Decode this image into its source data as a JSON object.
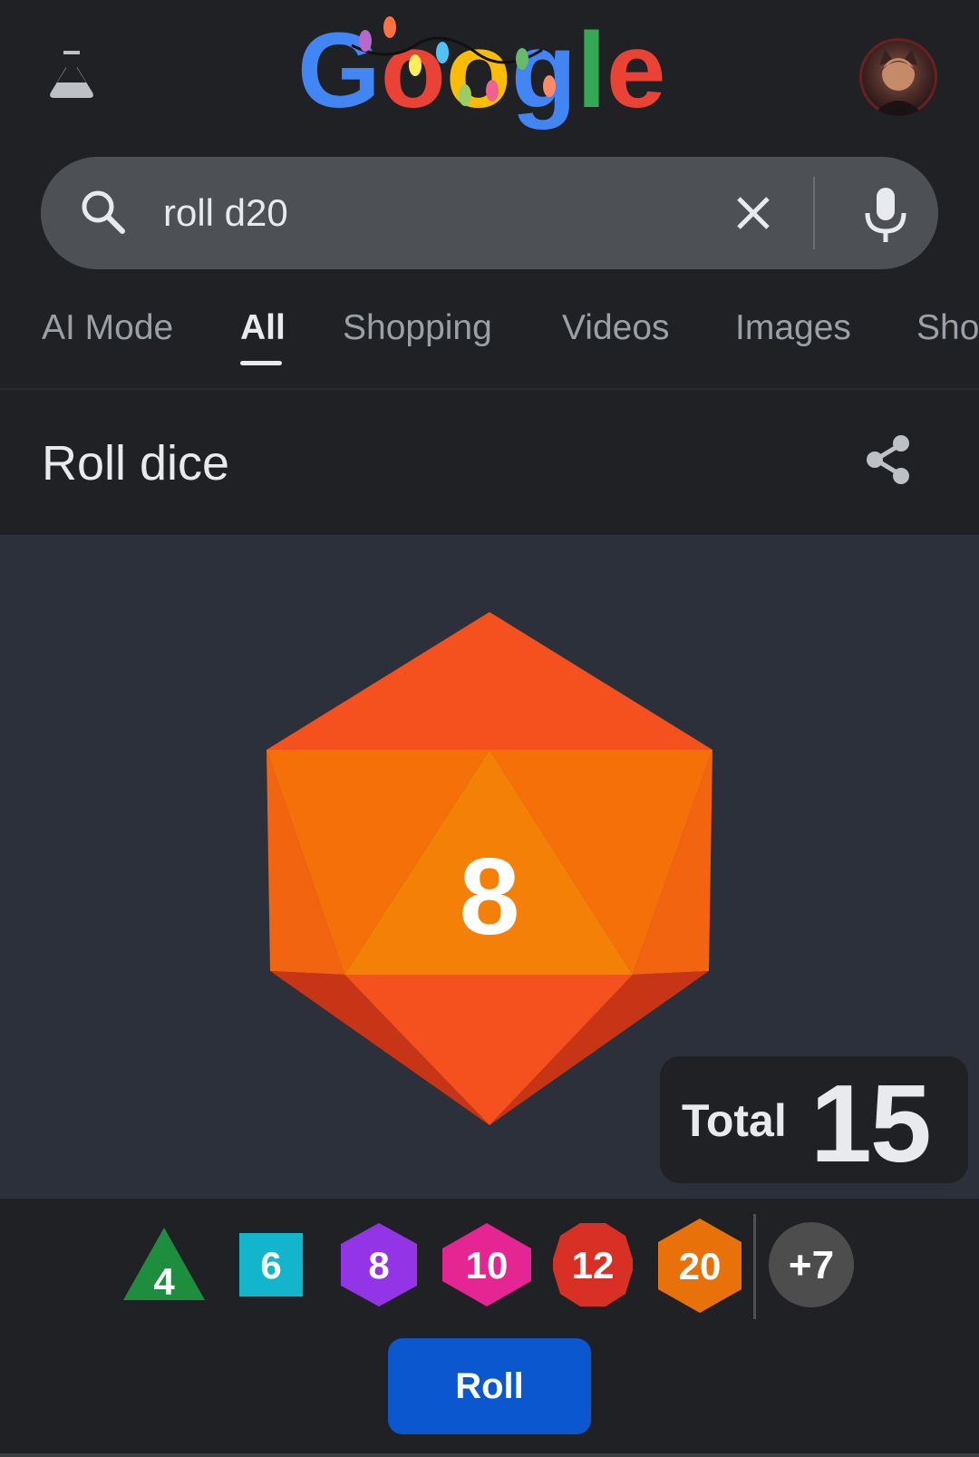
{
  "header": {
    "logo_text": "Google",
    "labs_icon": "labs-flask-icon",
    "avatar_icon": "profile-avatar"
  },
  "search": {
    "query": "roll d20",
    "search_icon": "search-icon",
    "clear_icon": "close-icon",
    "mic_icon": "microphone-icon"
  },
  "tabs": [
    {
      "label": "AI Mode",
      "active": false
    },
    {
      "label": "All",
      "active": true
    },
    {
      "label": "Shopping",
      "active": false
    },
    {
      "label": "Videos",
      "active": false
    },
    {
      "label": "Images",
      "active": false
    },
    {
      "label": "Sho",
      "active": false
    }
  ],
  "card": {
    "title": "Roll dice",
    "share_icon": "share-icon"
  },
  "roll_result": {
    "die_face": "8",
    "total_label": "Total",
    "total_value": "15"
  },
  "dice": [
    {
      "label": "4",
      "shape": "triangle",
      "color": "#1e8e3e"
    },
    {
      "label": "6",
      "shape": "square",
      "color": "#12b5cb"
    },
    {
      "label": "8",
      "shape": "hexagon",
      "color": "#9334e6"
    },
    {
      "label": "10",
      "shape": "diamond-hex",
      "color": "#e52592"
    },
    {
      "label": "12",
      "shape": "dodecagon",
      "color": "#d93025"
    },
    {
      "label": "20",
      "shape": "hexagon",
      "color": "#e8710a"
    },
    {
      "label": "+7",
      "shape": "circle",
      "color": "#4d4d4d"
    }
  ],
  "actions": {
    "roll_label": "Roll"
  },
  "colors": {
    "background": "#202124",
    "stage": "#2c303b",
    "accent_button": "#0b57d0",
    "d20_orange": "#f4511e"
  }
}
